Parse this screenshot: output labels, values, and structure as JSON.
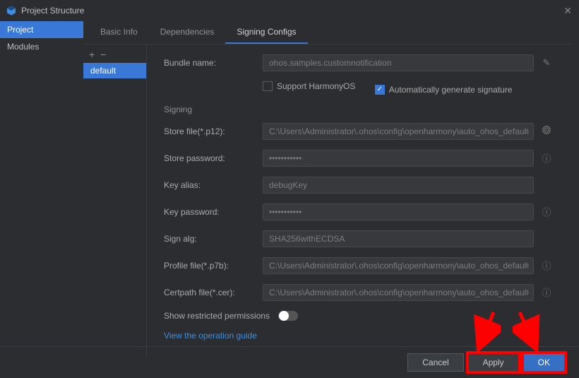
{
  "window": {
    "title": "Project Structure"
  },
  "sidebar": {
    "items": [
      "Project",
      "Modules"
    ],
    "active": 0
  },
  "tabs": {
    "items": [
      "Basic Info",
      "Dependencies",
      "Signing Configs"
    ],
    "active": 2
  },
  "configs": {
    "items": [
      "default"
    ],
    "active": 0,
    "add": "+",
    "remove": "−"
  },
  "form": {
    "bundle_name": {
      "label": "Bundle name:",
      "value": "ohos.samples.customnotification"
    },
    "support_harmony": {
      "label": "Support HarmonyOS",
      "checked": false
    },
    "auto_sig": {
      "label": "Automatically generate signature",
      "checked": true
    },
    "section_signing": "Signing",
    "store_file": {
      "label": "Store file(*.p12):",
      "value": "C:\\Users\\Administrator\\.ohos\\config\\openharmony\\auto_ohos_default"
    },
    "store_password": {
      "label": "Store password:",
      "value": "•••••••••••"
    },
    "key_alias": {
      "label": "Key alias:",
      "value": "debugKey"
    },
    "key_password": {
      "label": "Key password:",
      "value": "•••••••••••"
    },
    "sign_alg": {
      "label": "Sign alg:",
      "value": "SHA256withECDSA"
    },
    "profile_file": {
      "label": "Profile file(*.p7b):",
      "value": "C:\\Users\\Administrator\\.ohos\\config\\openharmony\\auto_ohos_default"
    },
    "certpath_file": {
      "label": "Certpath file(*.cer):",
      "value": "C:\\Users\\Administrator\\.ohos\\config\\openharmony\\auto_ohos_default"
    },
    "show_restricted": {
      "label": "Show restricted permissions",
      "enabled": false
    },
    "guide_link": "View the operation guide"
  },
  "footer": {
    "cancel": "Cancel",
    "apply": "Apply",
    "ok": "OK"
  },
  "icons": {
    "pencil": "✎",
    "help": "?",
    "fingerprint": "◉",
    "folder": "📁",
    "close": "✕",
    "check": "✓"
  }
}
